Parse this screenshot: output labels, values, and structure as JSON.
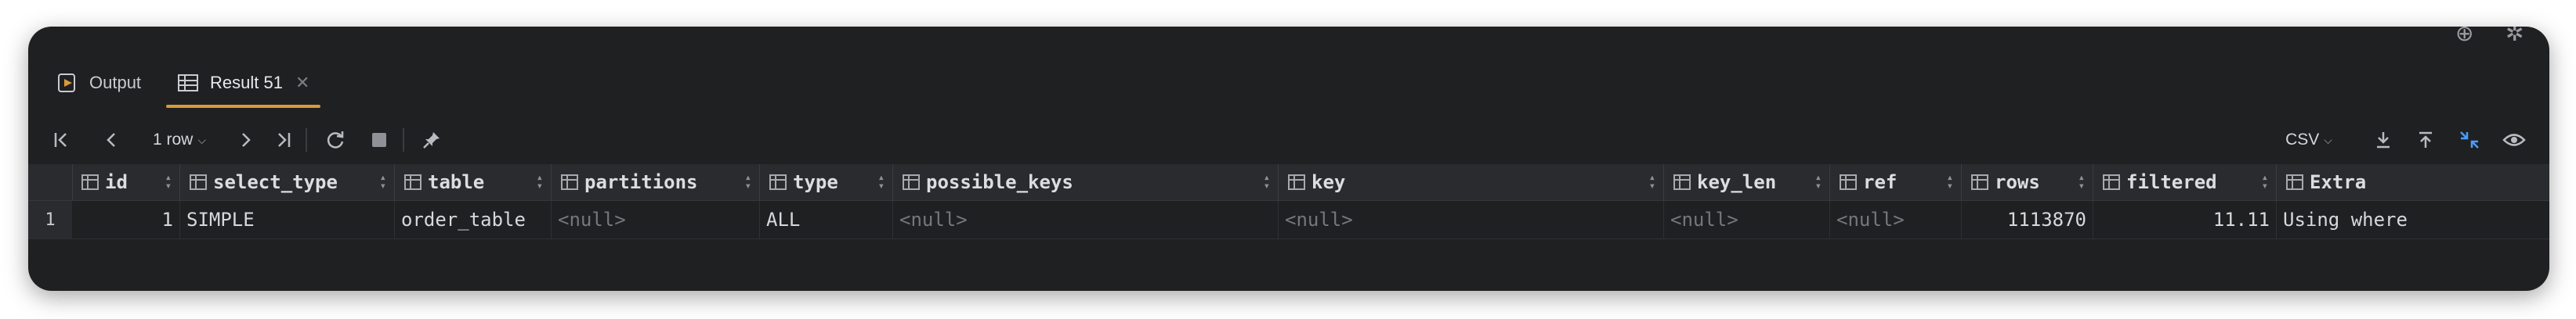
{
  "tabs": [
    {
      "label": "Output",
      "icon": "output-play-icon",
      "active": false
    },
    {
      "label": "Result 51",
      "icon": "grid-table-icon",
      "active": true
    }
  ],
  "toolbar": {
    "row_count": "1 row",
    "export_format": "CSV"
  },
  "columns": [
    "id",
    "select_type",
    "table",
    "partitions",
    "type",
    "possible_keys",
    "key",
    "key_len",
    "ref",
    "rows",
    "filtered",
    "Extra"
  ],
  "rows": [
    {
      "row_number": "1",
      "id": "1",
      "select_type": "SIMPLE",
      "table": "order_table",
      "partitions": "<null>",
      "type": "ALL",
      "possible_keys": "<null>",
      "key": "<null>",
      "key_len": "<null>",
      "ref": "<null>",
      "rows": "1113870",
      "filtered": "11.11",
      "Extra": "Using where"
    }
  ],
  "colors": {
    "window_bg": "#1f2022",
    "header_bg": "#2a2b2e",
    "active_tab_accent": "#d89a3a",
    "sync_icon_accent": "#4a9eff",
    "null_text": "#75777c"
  }
}
